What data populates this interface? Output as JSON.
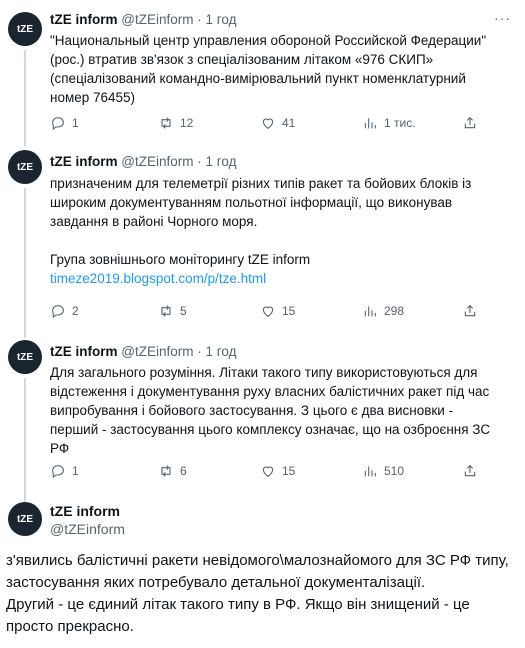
{
  "account": {
    "name": "tZE inform",
    "handle": "@tZEinform",
    "avatar_text": "tZE"
  },
  "menu_label": "···",
  "tweets": [
    {
      "time": "1 год",
      "lines": [
        "\"Национальный центр управления обороной Российской Федерации\"",
        "(рос.) втратив зв'язок з спеціалізованим літаком «976 СКИП»",
        "(спеціалізований командно-вимірювальний пункт  номенклатурний",
        "номер 76455)"
      ],
      "replies": "1",
      "reposts": "12",
      "likes": "41",
      "views": "1 тис."
    },
    {
      "time": "1 год",
      "lines": [
        "призначеним для телеметрії різних типів ракет та бойових блоків із",
        "широким документуванням польотної інформації, що виконував",
        "завдання в районі Чорного моря."
      ],
      "group_line": "Група зовнішнього моніторингу tZE inform",
      "link": "timeze2019.blogspot.com/p/tze.html",
      "replies": "2",
      "reposts": "5",
      "likes": "15",
      "views": "298"
    },
    {
      "time": "1 год",
      "lines": [
        "Для загального розуміння. Літаки такого типу використовуються для",
        "відстеження і документування руху власних балістичних ракет під час",
        "випробування і бойового застосування. З цього є два висновки -",
        "перший  - застосування цього комплексу означає, що на озброєння ЗС",
        "РФ"
      ],
      "replies": "1",
      "reposts": "6",
      "likes": "15",
      "views": "510"
    }
  ],
  "main_tweet": {
    "lines": [
      "з'явились балістичні ракети невідомого\\малознайомого для ЗС РФ типу,",
      "застосування яких  потребувало детальної документалізації.",
      "Другий - це єдиний літак такого типу в РФ. Якщо він знищений - це",
      "просто прекрасно."
    ]
  }
}
